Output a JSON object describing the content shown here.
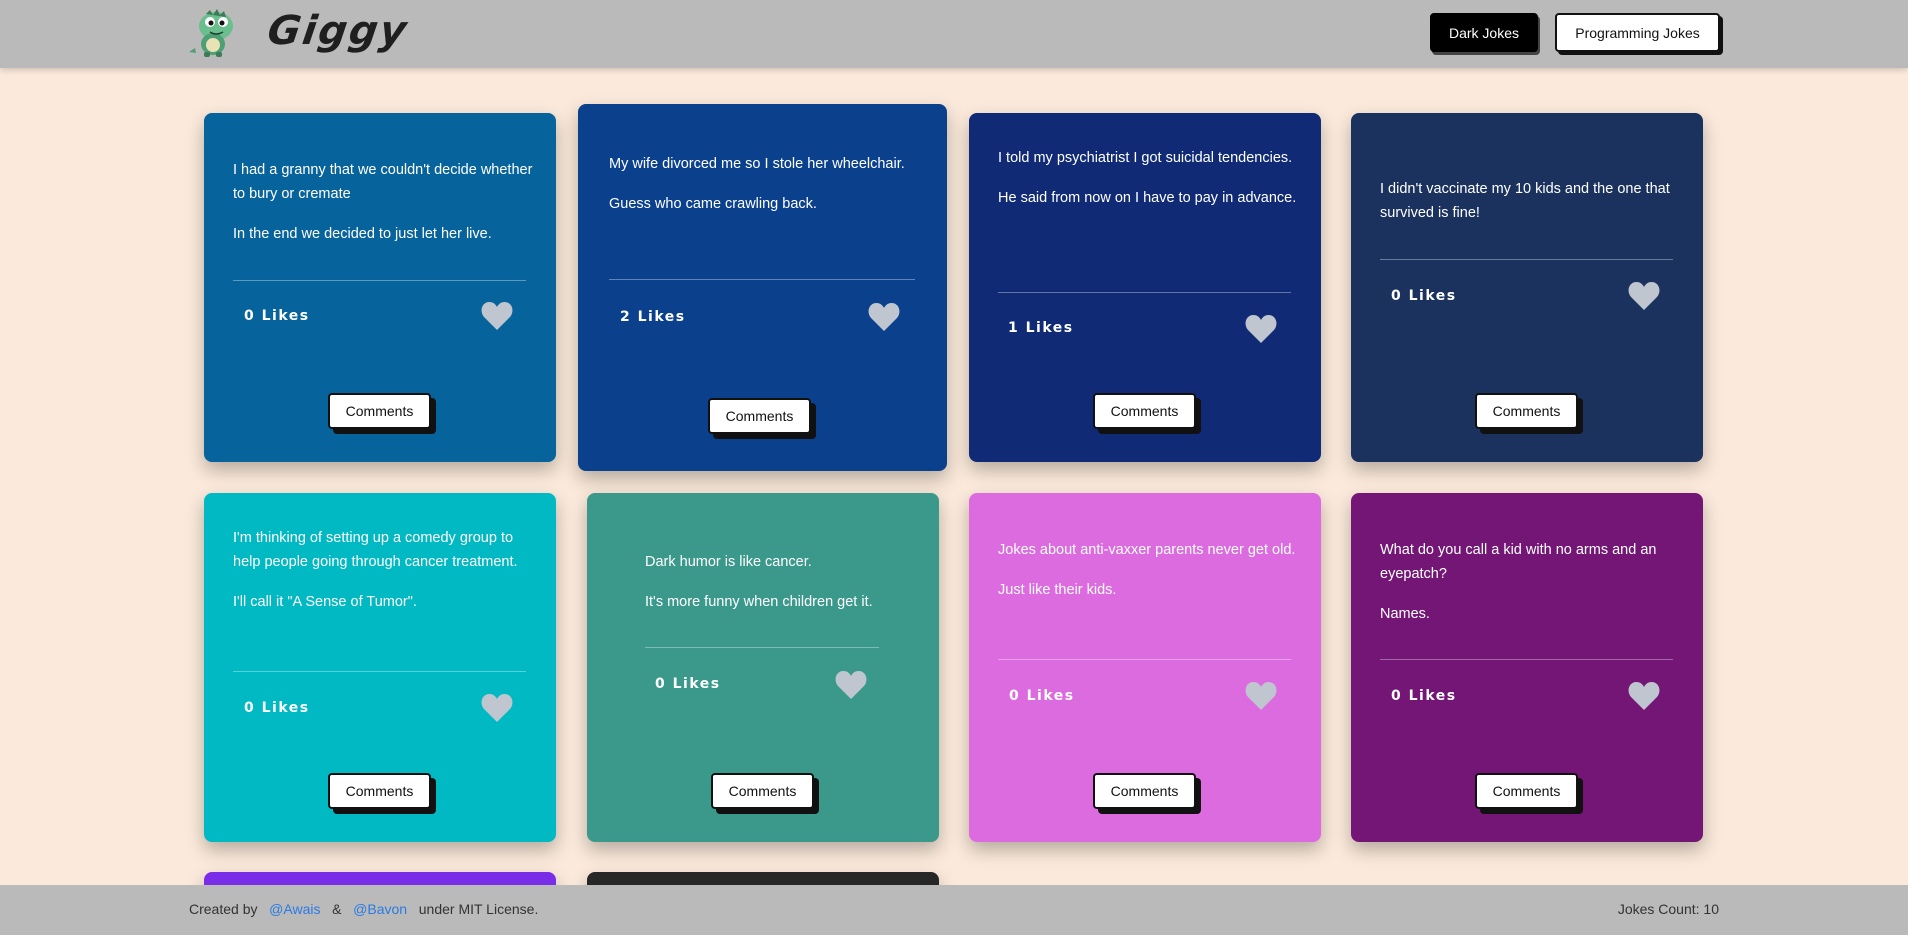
{
  "header": {
    "brand": "Giggy",
    "nav": {
      "dark_label": "Dark Jokes",
      "programming_label": "Programming Jokes"
    }
  },
  "comments_label": "Comments",
  "jokes": [
    {
      "lines": [
        "I had a granny that we couldn't decide whether to bury or cremate",
        "In the end we decided to just let her live."
      ],
      "likes_text": "0 Likes",
      "color": "#06639b"
    },
    {
      "lines": [
        "My wife divorced me so I stole her wheelchair.",
        "Guess who came crawling back."
      ],
      "likes_text": "2 Likes",
      "color": "#0b408c"
    },
    {
      "lines": [
        "I told my psychiatrist I got suicidal tendencies.",
        "He said from now on I have to pay in advance."
      ],
      "likes_text": "1 Likes",
      "color": "#102a75"
    },
    {
      "lines": [
        "I didn't vaccinate my 10 kids and the one that survived is fine!"
      ],
      "likes_text": "0 Likes",
      "color": "#1b325e"
    },
    {
      "lines": [
        "I'm thinking of setting up a comedy group to help people going through cancer treatment.",
        "I'll call it \"A Sense of Tumor\"."
      ],
      "likes_text": "0 Likes",
      "color": "#00b9c3"
    },
    {
      "lines": [
        "Dark humor is like cancer.",
        "It's more funny when children get it."
      ],
      "likes_text": "0 Likes",
      "color": "#3a998b"
    },
    {
      "lines": [
        "Jokes about anti-vaxxer parents never get old.",
        "Just like their kids."
      ],
      "likes_text": "0 Likes",
      "color": "#dd6be0"
    },
    {
      "lines": [
        "What do you call a kid with no arms and an eyepatch?",
        "Names."
      ],
      "likes_text": "0 Likes",
      "color": "#731675"
    },
    {
      "lines": [],
      "likes_text": "",
      "color": "#7a2de8"
    },
    {
      "lines": [],
      "likes_text": "",
      "color": "#272727"
    }
  ],
  "footer": {
    "created_by": "Created by",
    "author1": "@Awais",
    "amp": "&",
    "author2": "@Bavon",
    "license": "under MIT License.",
    "count": "Jokes Count: 10"
  },
  "colors": {
    "background": "#fbeadb",
    "header": "#bababa",
    "heart": "#c0c6cf",
    "link": "#2a7ae2"
  },
  "icons": {
    "logo": "dinosaur-logo-icon",
    "like": "heart-icon"
  }
}
